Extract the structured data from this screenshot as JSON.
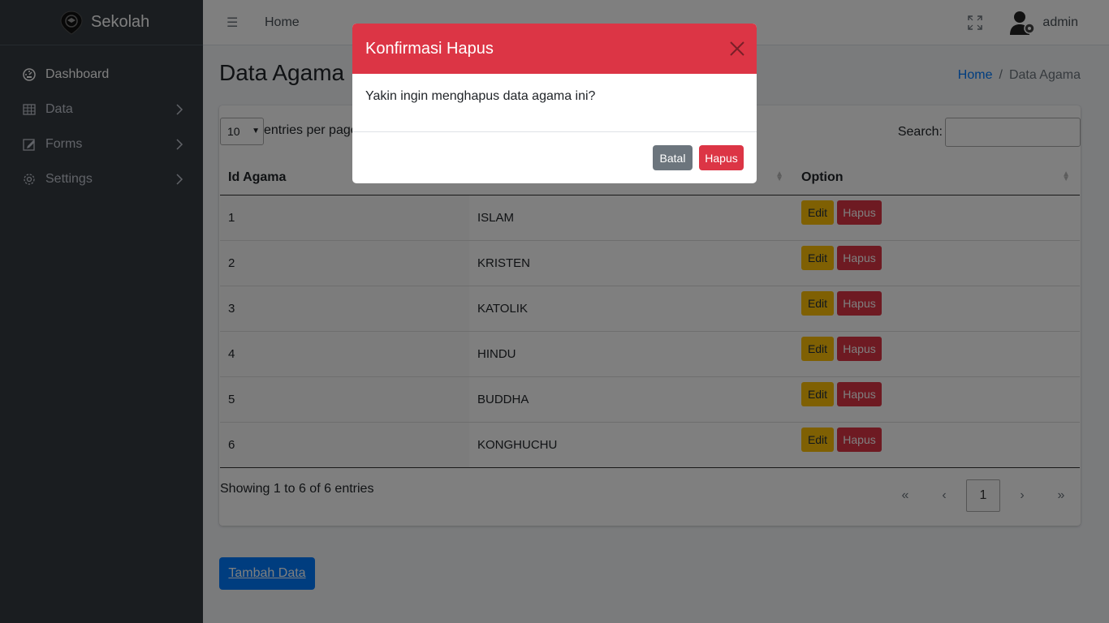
{
  "brand": {
    "name": "Sekolah"
  },
  "sidebar": {
    "items": [
      {
        "label": "Dashboard",
        "icon": "gauge-icon"
      },
      {
        "label": "Data",
        "icon": "table-icon"
      },
      {
        "label": "Forms",
        "icon": "edit-icon"
      },
      {
        "label": "Settings",
        "icon": "gear-icon"
      }
    ]
  },
  "topbar": {
    "menu_icon": "☰",
    "home_label": "Home",
    "user_name": "admin"
  },
  "page": {
    "title": "Data Agama",
    "breadcrumb": {
      "home": "Home",
      "current": "Data Agama"
    }
  },
  "table": {
    "length_value": "10",
    "length_label": "entries per page",
    "search_label": "Search:",
    "headers": {
      "id": "Id Agama",
      "name": "",
      "option": "Option"
    },
    "rows": [
      {
        "id": "1",
        "name": "ISLAM"
      },
      {
        "id": "2",
        "name": "KRISTEN"
      },
      {
        "id": "3",
        "name": "KATOLIK"
      },
      {
        "id": "4",
        "name": "HINDU"
      },
      {
        "id": "5",
        "name": "BUDDHA"
      },
      {
        "id": "6",
        "name": "KONGHUCHU"
      }
    ],
    "edit_label": "Edit",
    "delete_label": "Hapus",
    "info": "Showing 1 to 6 of 6 entries",
    "pager": {
      "first": "«",
      "prev": "‹",
      "current": "1",
      "next": "›",
      "last": "»"
    }
  },
  "add_button": "Tambah Data",
  "modal": {
    "title": "Konfirmasi Hapus",
    "body": "Yakin ingin menghapus data agama ini?",
    "cancel_label": "Batal",
    "confirm_label": "Hapus"
  },
  "colors": {
    "danger": "#dc3545",
    "warning": "#ffc107",
    "primary": "#007bff",
    "secondary": "#6c757d",
    "sidebar": "#343a40"
  }
}
